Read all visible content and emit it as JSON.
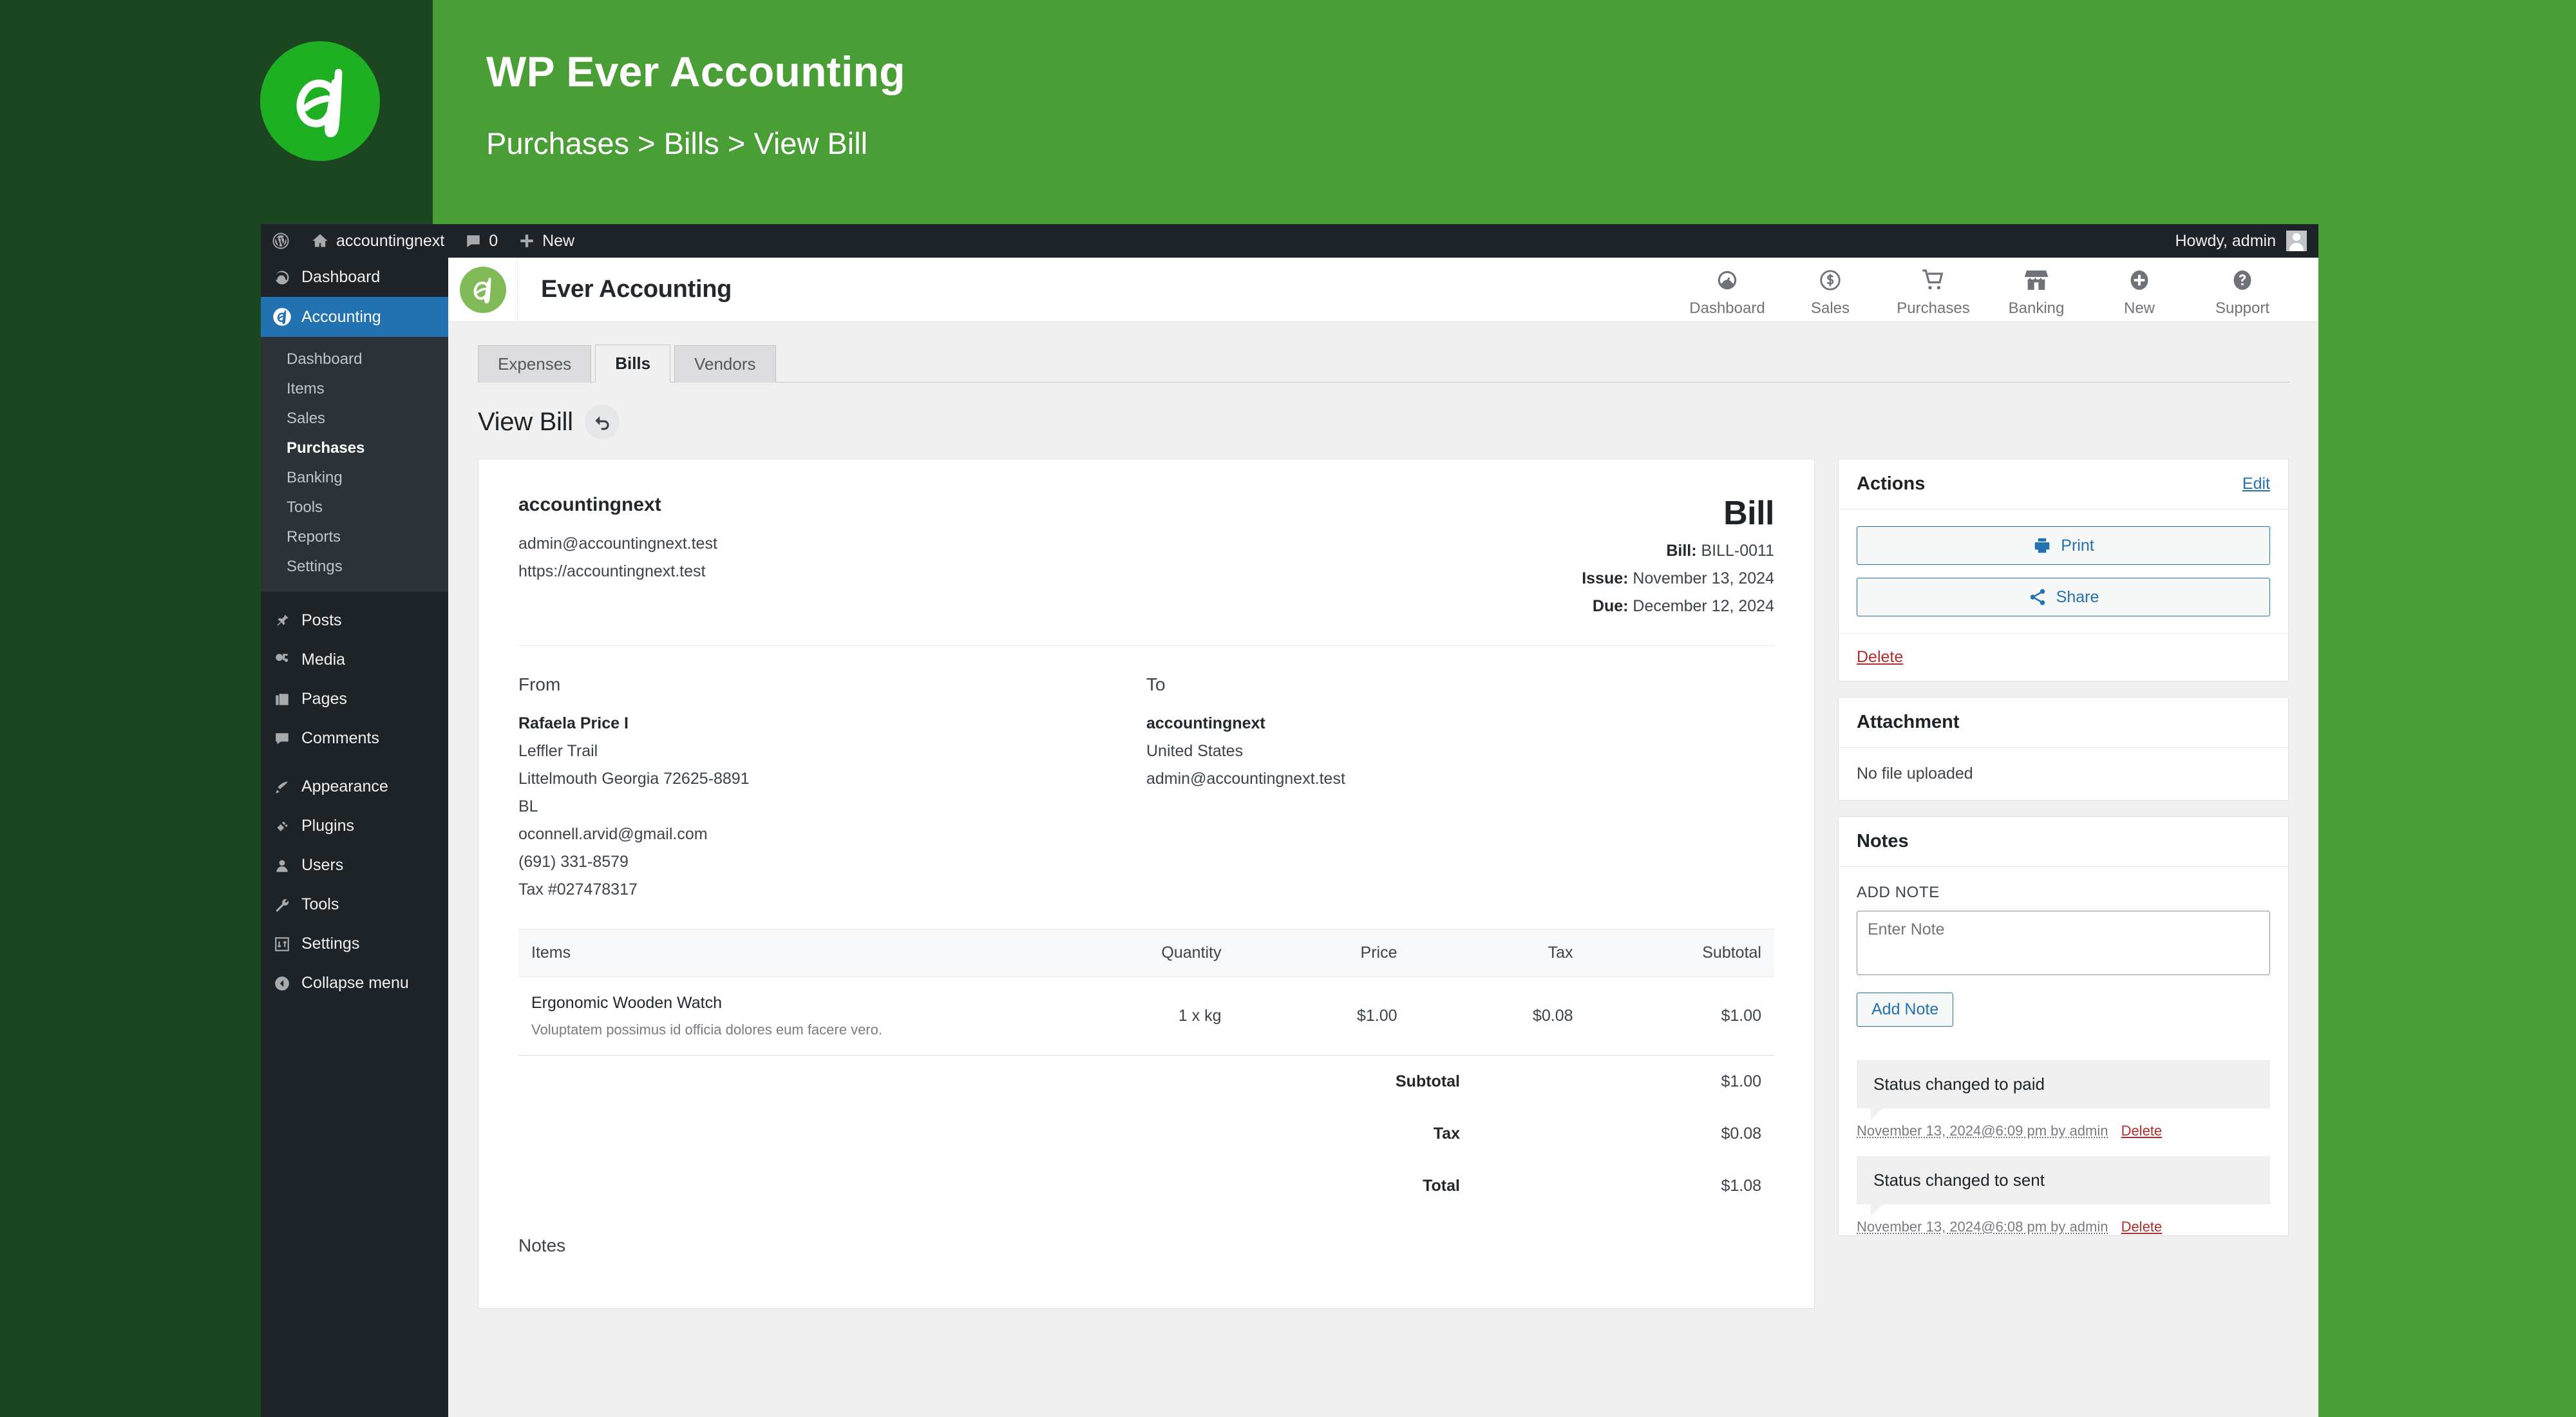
{
  "banner": {
    "title": "WP Ever Accounting",
    "breadcrumb": "Purchases > Bills > View Bill",
    "logo_icon": "ever-accounting-logo-icon",
    "dark_color": "#1b4620",
    "light_color": "#4a9e36"
  },
  "adminbar": {
    "wp_logo_icon": "wordpress-logo-icon",
    "site_icon": "home-icon",
    "site_name": "accountingnext",
    "comments_icon": "comment-bubble-icon",
    "comments_count": "0",
    "new_icon": "plus-icon",
    "new_label": "New",
    "howdy": "Howdy, admin",
    "avatar_icon": "user-avatar-icon"
  },
  "sidebar": {
    "top_items": [
      {
        "label": "Dashboard",
        "icon": "dashboard-gauge-icon",
        "current": false
      },
      {
        "label": "Accounting",
        "icon": "ever-accounting-icon",
        "current": true
      }
    ],
    "submenu": [
      {
        "label": "Dashboard",
        "active": false
      },
      {
        "label": "Items",
        "active": false
      },
      {
        "label": "Sales",
        "active": false
      },
      {
        "label": "Purchases",
        "active": true
      },
      {
        "label": "Banking",
        "active": false
      },
      {
        "label": "Tools",
        "active": false
      },
      {
        "label": "Reports",
        "active": false
      },
      {
        "label": "Settings",
        "active": false
      }
    ],
    "group_two": [
      {
        "label": "Posts",
        "icon": "pin-icon"
      },
      {
        "label": "Media",
        "icon": "media-icon"
      },
      {
        "label": "Pages",
        "icon": "pages-icon"
      },
      {
        "label": "Comments",
        "icon": "comment-bubble-icon"
      }
    ],
    "group_three": [
      {
        "label": "Appearance",
        "icon": "paintbrush-icon"
      },
      {
        "label": "Plugins",
        "icon": "plug-icon"
      },
      {
        "label": "Users",
        "icon": "user-icon"
      },
      {
        "label": "Tools",
        "icon": "wrench-icon"
      },
      {
        "label": "Settings",
        "icon": "settings-sliders-icon"
      },
      {
        "label": "Collapse menu",
        "icon": "collapse-arrow-icon"
      }
    ]
  },
  "ea_header": {
    "logo_icon": "ever-accounting-logo-icon",
    "title": "Ever Accounting",
    "nav": [
      {
        "label": "Dashboard",
        "icon": "dashboard-gauge-icon"
      },
      {
        "label": "Sales",
        "icon": "dollar-coin-icon"
      },
      {
        "label": "Purchases",
        "icon": "shopping-cart-icon"
      },
      {
        "label": "Banking",
        "icon": "store-icon"
      },
      {
        "label": "New",
        "icon": "plus-circle-icon"
      },
      {
        "label": "Support",
        "icon": "question-circle-icon"
      }
    ]
  },
  "tabs": [
    {
      "label": "Expenses",
      "active": false
    },
    {
      "label": "Bills",
      "active": true
    },
    {
      "label": "Vendors",
      "active": false
    }
  ],
  "page": {
    "title": "View Bill",
    "back_icon": "back-arrow-icon"
  },
  "bill": {
    "org_name": "accountingnext",
    "org_email": "admin@accountingnext.test",
    "org_url": "https://accountingnext.test",
    "doc_word": "Bill",
    "number_label": "Bill:",
    "number_value": "BILL-0011",
    "issue_label": "Issue:",
    "issue_value": "November 13, 2024",
    "due_label": "Due:",
    "due_value": "December 12, 2024",
    "from_head": "From",
    "to_head": "To",
    "from": {
      "name": "Rafaela Price I",
      "lines": [
        "Leffler Trail",
        "Littelmouth Georgia 72625-8891",
        "BL",
        "oconnell.arvid@gmail.com",
        "(691) 331-8579",
        "Tax #027478317"
      ]
    },
    "to": {
      "name": "accountingnext",
      "lines": [
        "United States",
        "admin@accountingnext.test"
      ]
    },
    "table": {
      "headers": [
        "Items",
        "Quantity",
        "Price",
        "Tax",
        "Subtotal"
      ],
      "rows": [
        {
          "name": "Ergonomic Wooden Watch",
          "desc": "Voluptatem possimus id officia dolores eum facere vero.",
          "quantity": "1 x kg",
          "price": "$1.00",
          "tax": "$0.08",
          "subtotal": "$1.00"
        }
      ],
      "totals": [
        {
          "label": "Subtotal",
          "value": "$1.00"
        },
        {
          "label": "Tax",
          "value": "$0.08"
        },
        {
          "label": "Total",
          "value": "$1.08"
        }
      ]
    },
    "notes_head": "Notes"
  },
  "actions": {
    "title": "Actions",
    "edit_label": "Edit",
    "print_label": "Print",
    "print_icon": "printer-icon",
    "share_label": "Share",
    "share_icon": "share-nodes-icon",
    "delete_label": "Delete"
  },
  "attachment": {
    "title": "Attachment",
    "empty_text": "No file uploaded"
  },
  "notes": {
    "title": "Notes",
    "add_label": "ADD NOTE",
    "input_placeholder": "Enter Note",
    "add_button": "Add Note",
    "items": [
      {
        "text": "Status changed to paid",
        "meta": "November 13, 2024@6:09 pm by admin",
        "delete_label": "Delete"
      },
      {
        "text": "Status changed to sent",
        "meta": "November 13, 2024@6:08 pm by admin",
        "delete_label": "Delete"
      }
    ]
  },
  "colors": {
    "wp_blue": "#2271b1",
    "wp_dark": "#1d2327",
    "brand_green": "#80bb58",
    "danger_red": "#b32d2e"
  }
}
